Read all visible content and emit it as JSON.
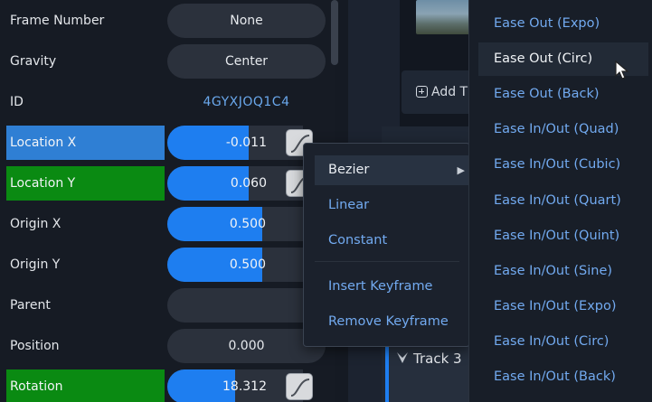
{
  "properties": [
    {
      "label": "Frame Number",
      "kind": "pill",
      "value": "None"
    },
    {
      "label": "Gravity",
      "kind": "pill",
      "value": "Center"
    },
    {
      "label": "ID",
      "kind": "text",
      "value": "4GYXJOQ1C4"
    },
    {
      "label": "Location X",
      "kind": "slider",
      "value": "-0.011",
      "fill_fraction": 0.6,
      "highlight": "blue",
      "keyframe_button": true
    },
    {
      "label": "Location Y",
      "kind": "slider",
      "value": "0.060",
      "fill_fraction": 0.6,
      "highlight": "green",
      "keyframe_button": true
    },
    {
      "label": "Origin X",
      "kind": "slider",
      "value": "0.500",
      "fill_fraction": 0.6
    },
    {
      "label": "Origin Y",
      "kind": "slider",
      "value": "0.500",
      "fill_fraction": 0.6
    },
    {
      "label": "Parent",
      "kind": "pill",
      "value": ""
    },
    {
      "label": "Position",
      "kind": "pill",
      "value": "0.000"
    },
    {
      "label": "Rotation",
      "kind": "slider",
      "value": "18.312",
      "fill_fraction": 0.5,
      "highlight": "green",
      "keyframe_button": true
    }
  ],
  "timeline": {
    "add_track_label": "Add T",
    "track_name": "Track 3"
  },
  "context_menu": {
    "items": [
      "Bezier",
      "Linear",
      "Constant",
      "Insert Keyframe",
      "Remove Keyframe"
    ],
    "active": "Bezier",
    "submenu_arrow": "▶"
  },
  "submenu": {
    "items": [
      "Ease Out (Expo)",
      "Ease Out (Circ)",
      "Ease Out (Back)",
      "Ease In/Out (Quad)",
      "Ease In/Out (Cubic)",
      "Ease In/Out (Quart)",
      "Ease In/Out (Quint)",
      "Ease In/Out (Sine)",
      "Ease In/Out (Expo)",
      "Ease In/Out (Circ)",
      "Ease In/Out (Back)"
    ],
    "active": "Ease Out (Circ)"
  },
  "colors": {
    "accent": "#1e7ef0",
    "highlight_blue": "#2f7fd4",
    "highlight_green": "#0a8a12",
    "menu_text": "#72aaf0"
  },
  "icons": {
    "keyframe": "curve-icon",
    "cursor": "mouse-pointer-icon",
    "add": "plus-square-icon",
    "expand": "chevron-down-icon",
    "submenu": "chevron-right-icon"
  }
}
